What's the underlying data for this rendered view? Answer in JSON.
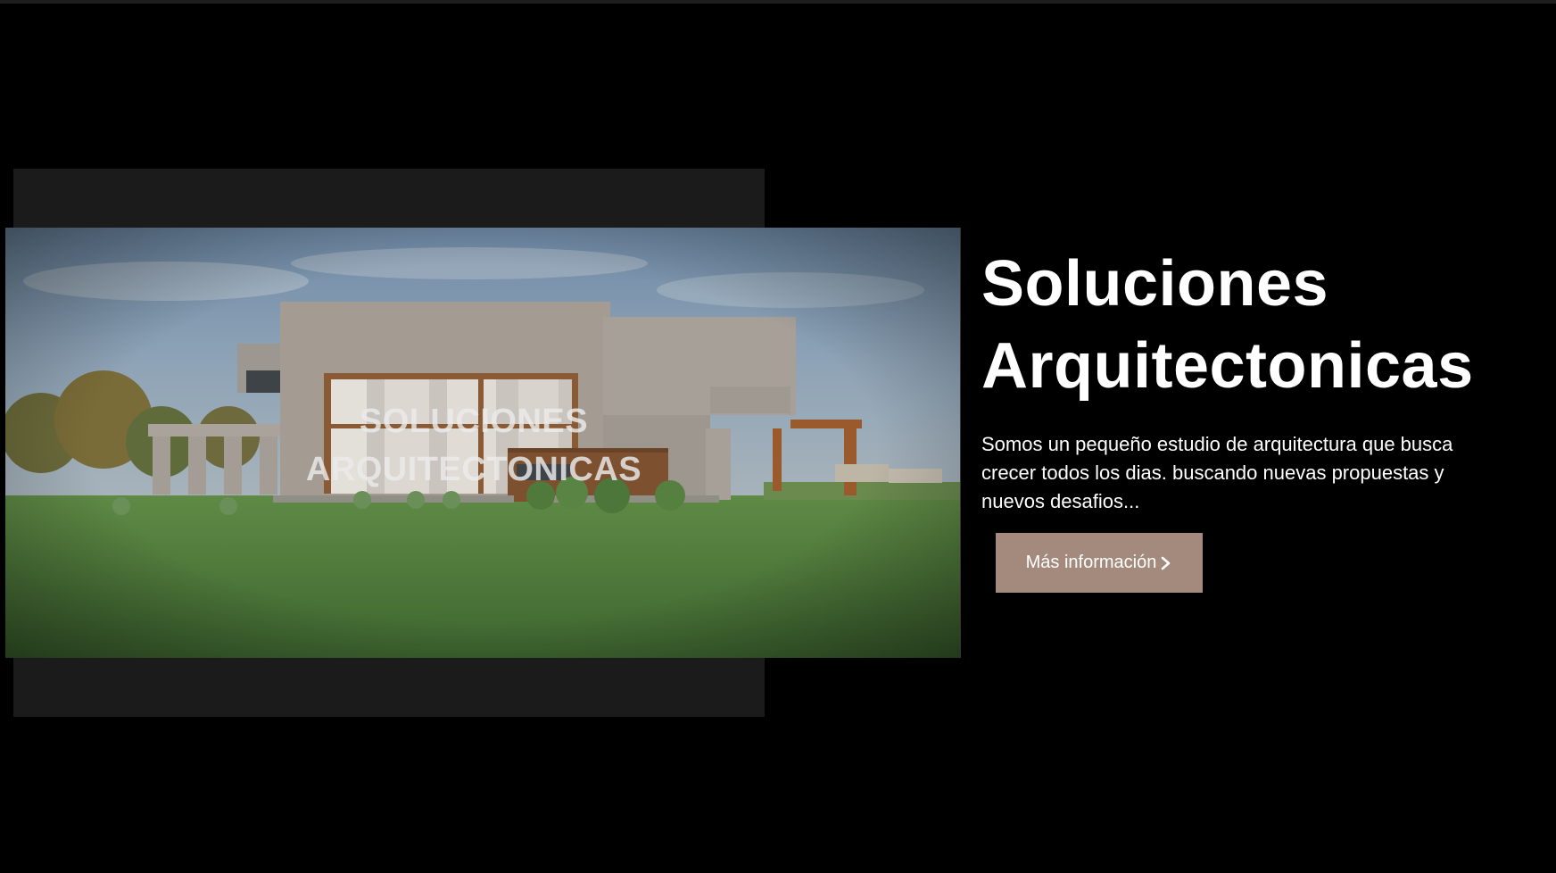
{
  "hero": {
    "image_alt": "Fachada de casa moderna de hormigón con jardín",
    "overlay_line1": "SOLUCIONES",
    "overlay_line2": "ARQUITECTONICAS",
    "headline_line1": "Soluciones",
    "headline_line2": "Arquitectonicas",
    "description": "Somos un pequeño estudio de arquitectura que busca crecer todos los dias. buscando nuevas propuestas y nuevos desafios...",
    "cta_label": "Más información",
    "cta_icon": "chevron-right-icon"
  },
  "colors": {
    "background": "#000000",
    "panel": "#1b1b1b",
    "button": "#a48a7c",
    "text": "#ffffff"
  }
}
